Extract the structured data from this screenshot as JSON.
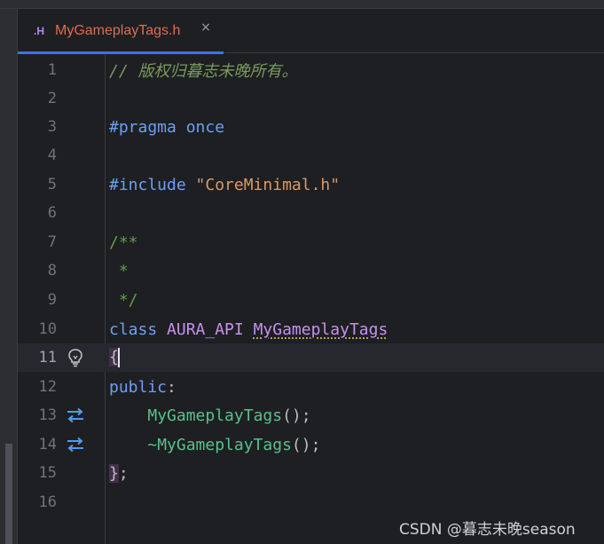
{
  "tab": {
    "file_type": ".H",
    "title": "MyGameplayTags.h",
    "close": "×"
  },
  "lines": {
    "n1": "1",
    "n2": "2",
    "n3": "3",
    "n4": "4",
    "n5": "5",
    "n6": "6",
    "n7": "7",
    "n8": "8",
    "n9": "9",
    "n10": "10",
    "n11": "11",
    "n12": "12",
    "n13": "13",
    "n14": "14",
    "n15": "15",
    "n16": "16"
  },
  "code": {
    "l1_comment": "// 版权归暮志未晚所有。",
    "l3_kw": "#pragma",
    "l3_rest": " once",
    "l5_kw": "#include",
    "l5_str": " \"CoreMinimal.h\"",
    "l7": "/**",
    "l8": " *",
    "l9": " */",
    "l10_kw": "class",
    "l10_macro": " AURA_API",
    "l10_space": " ",
    "l10_type": "MyGameplayTags",
    "l11_brace": "{",
    "l12_kw": "public",
    "l12_colon": ":",
    "l13_indent": "    ",
    "l13_fn": "MyGameplayTags",
    "l13_rest": "();",
    "l14_indent": "    ",
    "l14_fn": "~MyGameplayTags",
    "l14_rest": "();",
    "l15_brace": "}",
    "l15_semi": ";"
  },
  "watermark": "CSDN @暮志未晚season",
  "colors": {
    "background": "#1e1f22",
    "keyword": "#6d9ff5",
    "string": "#d89a6a",
    "function": "#57c28b",
    "macro": "#c791f0",
    "comment": "#7a9a5c",
    "tab_title": "#e06c4f",
    "tab_underline": "#3574f0"
  },
  "icons": {
    "line11": "lightbulb-icon",
    "line13": "navigate-implementation-icon",
    "line14": "navigate-implementation-icon"
  }
}
